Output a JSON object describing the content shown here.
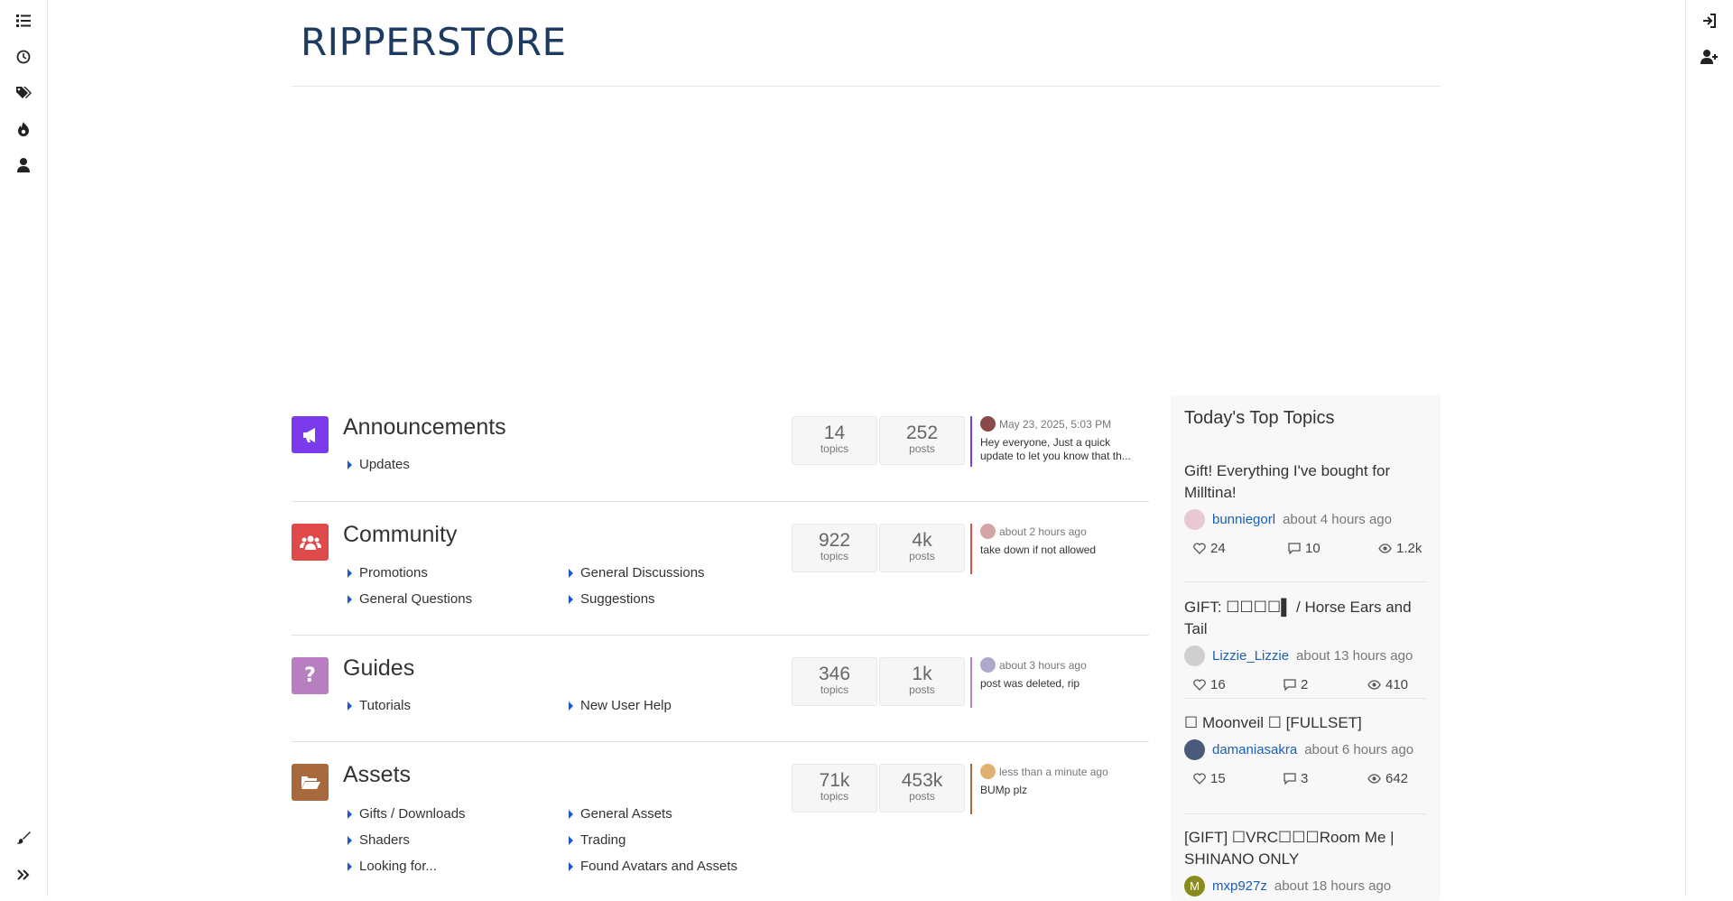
{
  "brand": "RIPPERSTORE",
  "left_nav": [
    "list-icon",
    "clock-icon",
    "tags-icon",
    "fire-icon",
    "user-icon",
    "brush-icon",
    "expand-icon"
  ],
  "right_nav": [
    "login-icon",
    "register-icon"
  ],
  "categories": [
    {
      "title": "Announcements",
      "icon": "bullhorn-icon",
      "color": "#7c3aed",
      "subs": [
        "Updates"
      ],
      "topics": "14",
      "posts": "252",
      "topics_label": "topics",
      "posts_label": "posts",
      "last_time": "May 23, 2025, 5:03 PM",
      "last_text": "Hey everyone, Just a quick update to let you know that th...",
      "line_color": "#7c3aed"
    },
    {
      "title": "Community",
      "icon": "users-icon",
      "color": "#e04a4a",
      "subs": [
        "Promotions",
        "General Discussions",
        "General Questions",
        "Suggestions"
      ],
      "topics": "922",
      "posts": "4k",
      "topics_label": "topics",
      "posts_label": "posts",
      "last_time": "about 2 hours ago",
      "last_text": "take down if not allowed",
      "line_color": "#e04a4a"
    },
    {
      "title": "Guides",
      "icon": "question-icon",
      "color": "#b77fbf",
      "subs": [
        "Tutorials",
        "New User Help"
      ],
      "topics": "346",
      "posts": "1k",
      "topics_label": "topics",
      "posts_label": "posts",
      "last_time": "about 3 hours ago",
      "last_text": "post was deleted, rip",
      "line_color": "#b77fbf"
    },
    {
      "title": "Assets",
      "icon": "folder-open-icon",
      "color": "#a86a3d",
      "subs": [
        "Gifts / Downloads",
        "General Assets",
        "Shaders",
        "Trading",
        "Looking for...",
        "Found Avatars and Assets"
      ],
      "topics": "71k",
      "posts": "453k",
      "topics_label": "topics",
      "posts_label": "posts",
      "last_time": "less than a minute ago",
      "last_text": "BUMp plz",
      "line_color": "#a86a3d"
    }
  ],
  "top_topics": {
    "heading": "Today's Top Topics",
    "items": [
      {
        "title": "Gift! Everything I've bought for Milltina!",
        "user": "bunniegorl",
        "when": "about 4 hours ago",
        "likes": "24",
        "replies": "10",
        "views": "1.2k",
        "avatar_color": "#e8c9d3"
      },
      {
        "title": "GIFT: ☐☐☐☐▌ / Horse Ears and Tail",
        "user": "Lizzie_Lizzie",
        "when": "about 13 hours ago",
        "likes": "16",
        "replies": "2",
        "views": "410",
        "avatar_color": "#cfcfcf"
      },
      {
        "title": "☐ Moonveil ☐ [FULLSET]",
        "user": "damaniasakra",
        "when": "about 6 hours ago",
        "likes": "15",
        "replies": "3",
        "views": "642",
        "avatar_color": "#4a5a7a"
      },
      {
        "title": "[GIFT] ☐VRC☐☐☐Room Me | SHINANO ONLY",
        "user": "mxp927z",
        "when": "about 18 hours ago",
        "likes": "",
        "replies": "",
        "views": "",
        "avatar_color": "#8a8a1e",
        "avatar_letter": "M"
      }
    ]
  }
}
